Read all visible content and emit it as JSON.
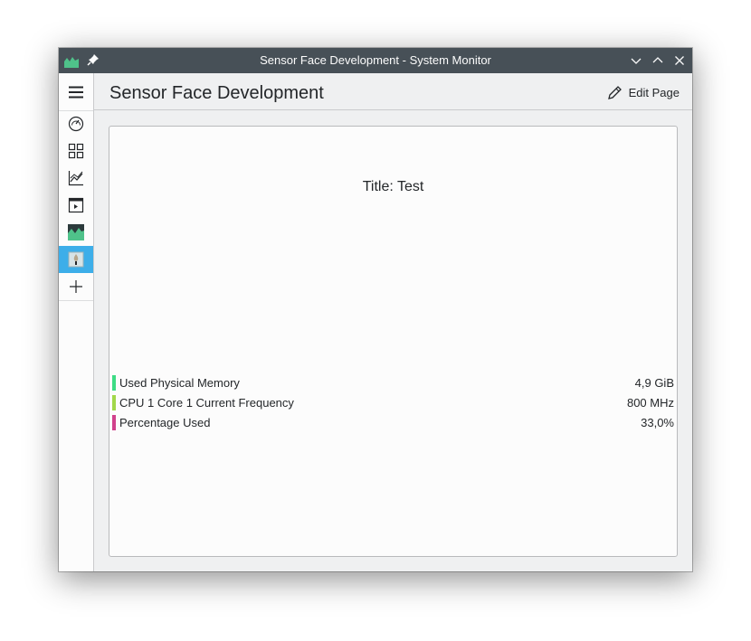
{
  "window": {
    "title": "Sensor Face Development - System Monitor"
  },
  "sidebar": {
    "items": [
      {
        "name": "menu",
        "icon": "hamburger-menu-icon"
      },
      {
        "name": "overview",
        "icon": "speedometer-icon"
      },
      {
        "name": "applications",
        "icon": "grid-icon"
      },
      {
        "name": "history",
        "icon": "line-chart-icon"
      },
      {
        "name": "processes",
        "icon": "terminal-window-icon"
      },
      {
        "name": "system-monitor-page",
        "icon": "area-chart-icon"
      },
      {
        "name": "sensor-face-development",
        "icon": "sensor-face-icon",
        "active": true
      },
      {
        "name": "add-page",
        "icon": "plus-icon"
      }
    ]
  },
  "header": {
    "page_title": "Sensor Face Development",
    "edit_label": "Edit Page"
  },
  "face": {
    "title": "Title: Test",
    "legend": [
      {
        "name": "Used Physical Memory",
        "value": "4,9 GiB",
        "color": "#3ddc84"
      },
      {
        "name": "CPU 1 Core 1 Current Frequency",
        "value": "800 MHz",
        "color": "#a2d84a"
      },
      {
        "name": "Percentage Used",
        "value": "33,0%",
        "color": "#d1418c"
      }
    ]
  },
  "colors": {
    "titlebar": "#475057",
    "accent": "#3daee9",
    "background": "#eff0f1",
    "card": "#fcfcfc"
  }
}
